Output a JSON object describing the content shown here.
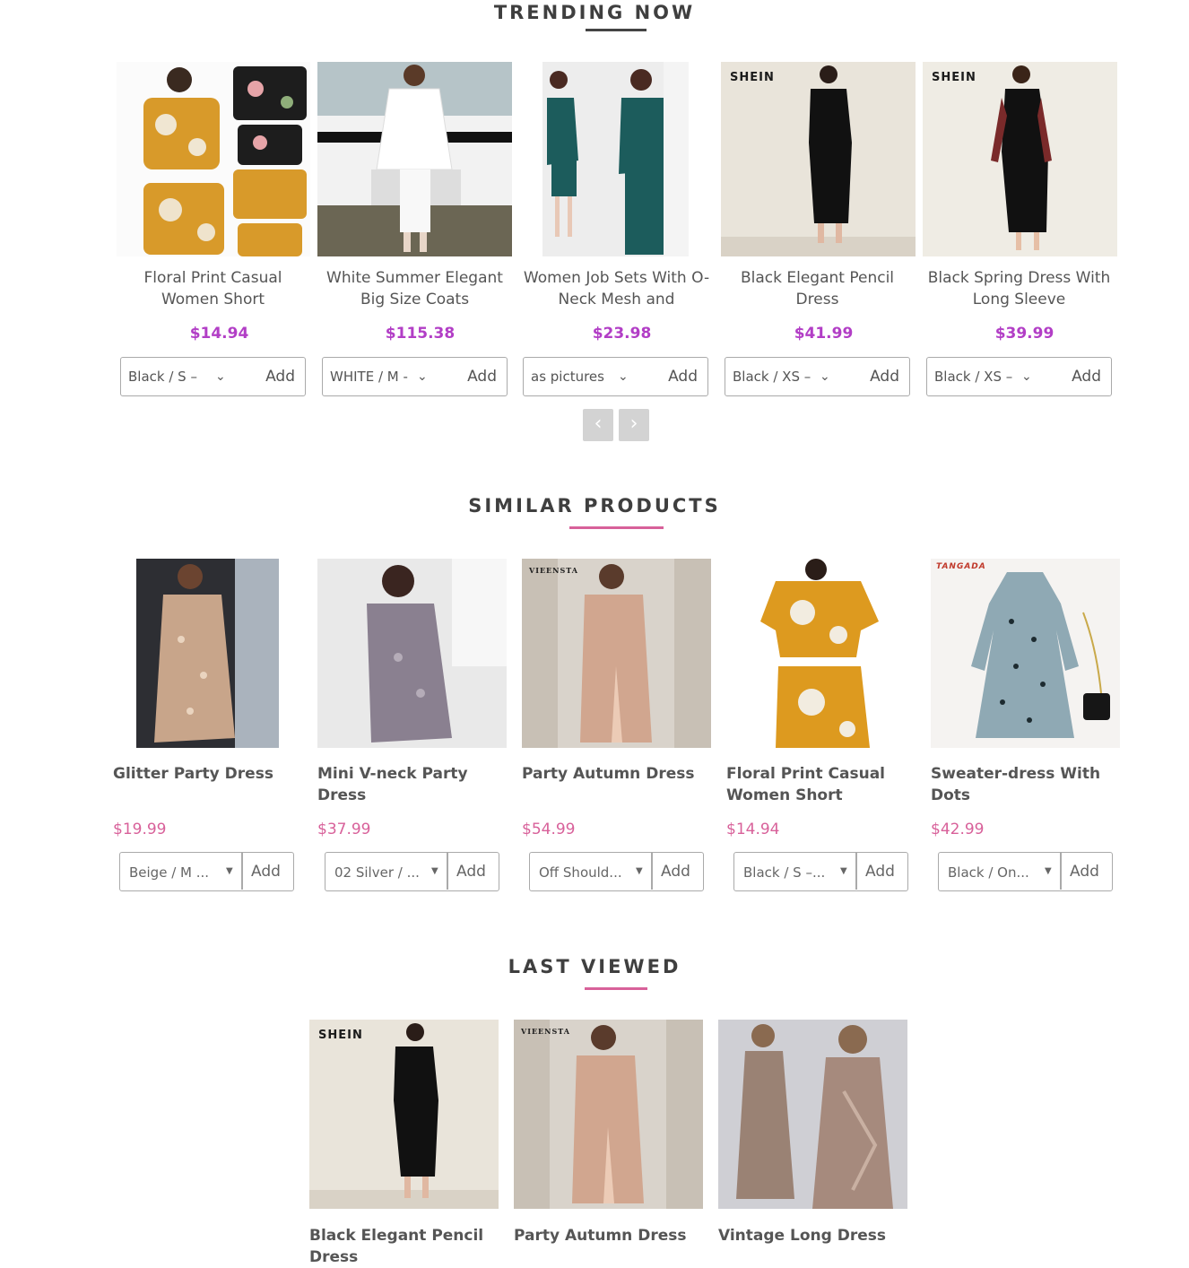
{
  "colors": {
    "trending_price": "#b23ec6",
    "similar_price": "#d8619a",
    "accent_underline": "#d8619a",
    "dark_underline": "#444444"
  },
  "trending": {
    "title": "TRENDING NOW",
    "products": [
      {
        "name": "Floral Print Casual Women Short",
        "price": "$14.94",
        "option": "Black / S –",
        "add": "Add",
        "brand": ""
      },
      {
        "name": "White Summer Elegant Big Size Coats",
        "price": "$115.38",
        "option": "WHITE / M -",
        "add": "Add",
        "brand": ""
      },
      {
        "name": "Women Job Sets With O-Neck Mesh and",
        "price": "$23.98",
        "option": "as pictures",
        "add": "Add",
        "brand": ""
      },
      {
        "name": "Black Elegant Pencil Dress",
        "price": "$41.99",
        "option": "Black / XS –",
        "add": "Add",
        "brand": "SHEIN"
      },
      {
        "name": "Black Spring Dress With Long Sleeve",
        "price": "$39.99",
        "option": "Black / XS –",
        "add": "Add",
        "brand": "SHEIN"
      }
    ],
    "prev_icon": "chevron-left-icon",
    "next_icon": "chevron-right-icon"
  },
  "similar": {
    "title": "SIMILAR PRODUCTS",
    "products": [
      {
        "name": "Glitter Party Dress",
        "price": "$19.99",
        "option": "Beige / M ...",
        "add": "Add",
        "brand": ""
      },
      {
        "name": "Mini V-neck Party Dress",
        "price": "$37.99",
        "option": "02 Silver / ...",
        "add": "Add",
        "brand": ""
      },
      {
        "name": "Party Autumn Dress",
        "price": "$54.99",
        "option": "Off Should...",
        "add": "Add",
        "brand": "VIEENSTA"
      },
      {
        "name": "Floral Print Casual Women Short",
        "price": "$14.94",
        "option": "Black / S –...",
        "add": "Add",
        "brand": ""
      },
      {
        "name": "Sweater-dress With Dots",
        "price": "$42.99",
        "option": "Black / On...",
        "add": "Add",
        "brand": "TANGADA"
      }
    ]
  },
  "last_viewed": {
    "title": "LAST VIEWED",
    "products": [
      {
        "name": "Black Elegant Pencil Dress",
        "brand": "SHEIN"
      },
      {
        "name": "Party Autumn Dress",
        "brand": "VIEENSTA"
      },
      {
        "name": "Vintage Long Dress",
        "brand": ""
      }
    ]
  }
}
